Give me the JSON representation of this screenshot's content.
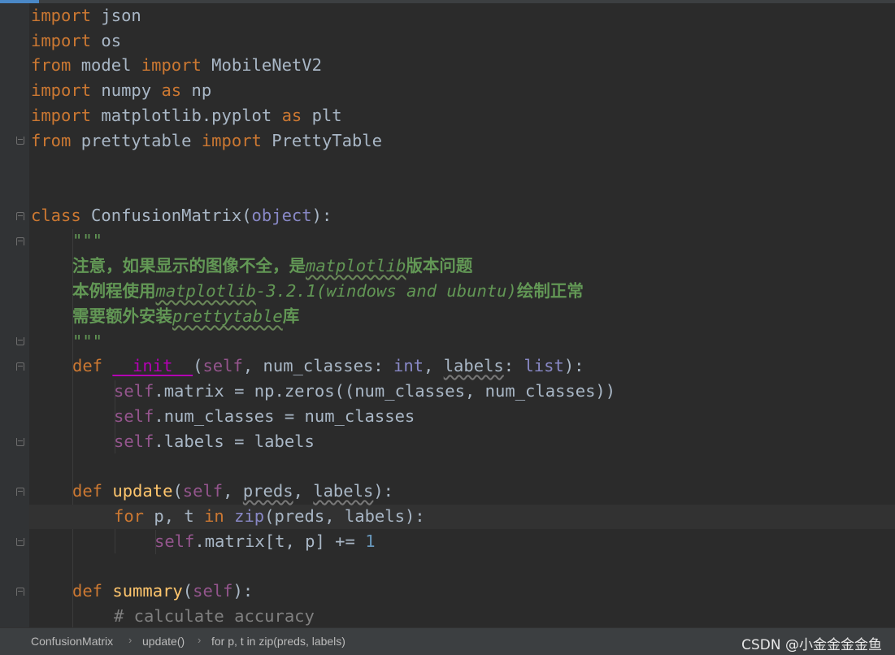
{
  "editor": {
    "lines": [
      {
        "kw": "import",
        "rest": " json"
      },
      {
        "kw": "import",
        "rest": " os"
      },
      {
        "kw1": "from",
        "mid": " model ",
        "kw2": "import",
        "rest": " MobileNetV2"
      },
      {
        "kw": "import",
        "mid": " numpy ",
        "kw2": "as",
        "rest": " np"
      },
      {
        "kw": "import",
        "mid": " matplotlib.pyplot ",
        "kw2": "as",
        "rest": " plt"
      },
      {
        "kw1": "from",
        "mid": " prettytable ",
        "kw2": "import",
        "rest": " PrettyTable"
      }
    ],
    "class_line": {
      "kw": "class",
      "name": " ConfusionMatrix(",
      "base": "object",
      "end": "):"
    },
    "doc_open": "\"\"\"",
    "doc_line1_cjk_a": "注意，如果显示的图像不全，是",
    "doc_line1_typo": "matplotlib",
    "doc_line1_cjk_b": "版本问题",
    "doc_line2_cjk_a": "本例程使用",
    "doc_line2_typo": "matplotlib",
    "doc_line2_text": "-3.2.1(windows and ubuntu)",
    "doc_line2_cjk_b": "绘制正常",
    "doc_line3_cjk_a": "需要额外安装",
    "doc_line3_typo": "prettytable",
    "doc_line3_cjk_b": "库",
    "doc_close": "\"\"\"",
    "init": {
      "def": "def",
      "name": "__init__",
      "open": "(",
      "self": "self",
      "p1": ", num_classes: ",
      "t1": "int",
      "p2a": ", ",
      "p2": "labels",
      "p2b": ": ",
      "t2": "list",
      "close": "):"
    },
    "init_body": [
      {
        "self": "self",
        "rest": ".matrix = np.zeros((num_classes, num_classes))"
      },
      {
        "self": "self",
        "rest": ".num_classes = num_classes"
      },
      {
        "self": "self",
        "rest": ".labels = labels"
      }
    ],
    "update": {
      "def": "def",
      "name": " update",
      "open": "(",
      "self": "self",
      "sep1": ", ",
      "a1": "preds",
      "sep2": ", ",
      "a2": "labels",
      "close": "):"
    },
    "for_line": {
      "kw": "for",
      "vars": " p, t ",
      "in": "in",
      "sp": " ",
      "zip": "zip",
      "args": "(preds, labels):"
    },
    "matrix_line": {
      "self": "self",
      "rest": ".matrix[t, p] += ",
      "num": "1"
    },
    "summary": {
      "def": "def",
      "name": " summary",
      "args": "(",
      "self": "self",
      "close": "):"
    },
    "comment": "# calculate accuracy"
  },
  "breadcrumb": [
    "ConfusionMatrix",
    "update()",
    "for p, t in zip(preds, labels)"
  ],
  "watermark": "CSDN @小金金金金鱼"
}
